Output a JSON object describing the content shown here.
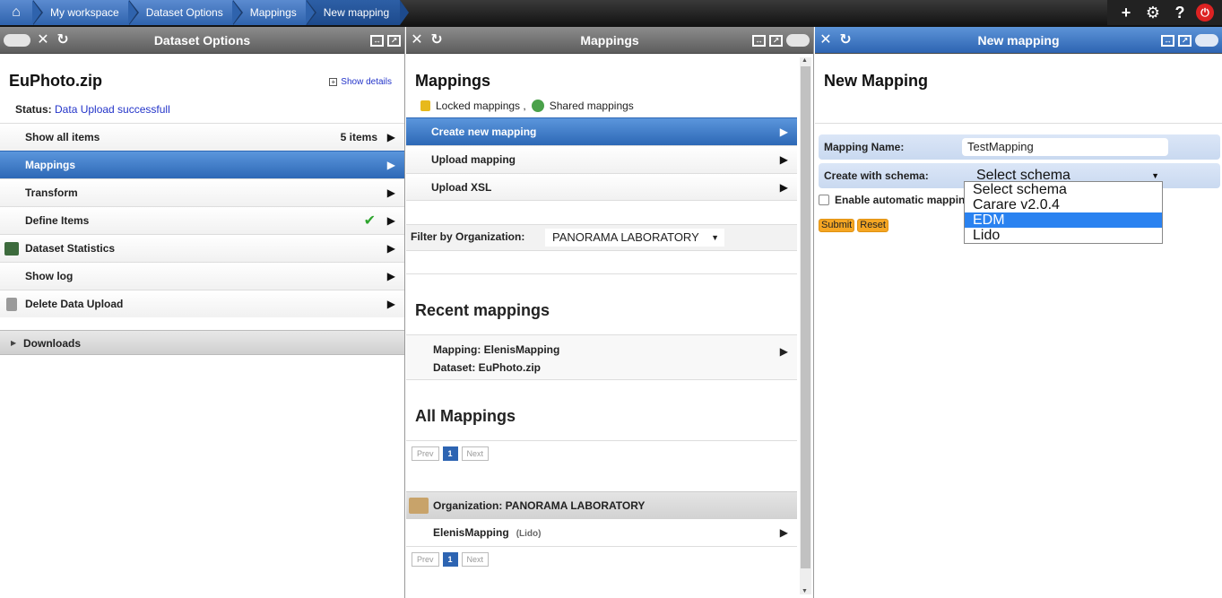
{
  "breadcrumb": [
    "My workspace",
    "Dataset Options",
    "Mappings",
    "New mapping"
  ],
  "top_icons": [
    "plus-icon",
    "gear-icon",
    "help-icon",
    "power-icon"
  ],
  "panel1": {
    "header": "Dataset Options",
    "title": "EuPhoto.zip",
    "show_details": "Show details",
    "status_label": "Status:",
    "status_value": "Data Upload successfull",
    "items": [
      {
        "label": "Show all items",
        "extra": "5 items"
      },
      {
        "label": "Mappings",
        "active": true
      },
      {
        "label": "Transform"
      },
      {
        "label": "Define Items",
        "check": true
      },
      {
        "label": "Dataset Statistics",
        "icon": "chart-icon"
      },
      {
        "label": "Show log"
      },
      {
        "label": "Delete Data Upload",
        "icon": "trash-icon"
      }
    ],
    "downloads": "Downloads"
  },
  "panel2": {
    "header": "Mappings",
    "title": "Mappings",
    "locked": "Locked mappings ,",
    "shared": "Shared mappings",
    "items": [
      "Create new mapping",
      "Upload mapping",
      "Upload XSL"
    ],
    "filter_label": "Filter by Organization:",
    "filter_value": "PANORAMA LABORATORY",
    "recent_title": "Recent mappings",
    "recent_mapping": "Mapping: ElenisMapping",
    "recent_dataset": "Dataset: EuPhoto.zip",
    "all_title": "All Mappings",
    "pager": {
      "prev": "Prev",
      "page": "1",
      "next": "Next"
    },
    "org_label": "Organization: PANORAMA LABORATORY",
    "mapping_name": "ElenisMapping",
    "mapping_schema": "(Lido)"
  },
  "panel3": {
    "header": "New mapping",
    "title": "New Mapping",
    "name_label": "Mapping Name:",
    "name_value": "TestMapping",
    "schema_label": "Create with schema:",
    "schema_value": "Select schema",
    "auto_label": "Enable automatic mapping",
    "submit": "Submit",
    "reset": "Reset",
    "schema_options": [
      "Select schema",
      "Carare v2.0.4",
      "EDM",
      "Lido"
    ],
    "highlighted_option": "EDM"
  }
}
